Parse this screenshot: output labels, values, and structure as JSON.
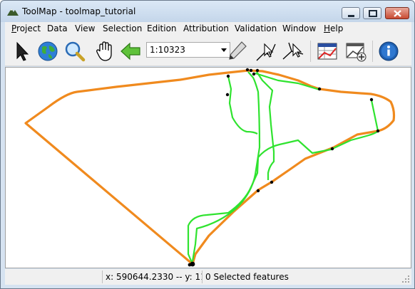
{
  "window": {
    "title": "ToolMap - toolmap_tutorial",
    "controls": [
      "minimize",
      "maximize",
      "close"
    ]
  },
  "menubar": {
    "items": [
      {
        "label": "Project"
      },
      {
        "label": "Data"
      },
      {
        "label": "View"
      },
      {
        "label": "Selection"
      },
      {
        "label": "Edition"
      },
      {
        "label": "Attribution"
      },
      {
        "label": "Validation"
      },
      {
        "label": "Window"
      },
      {
        "label": "Help"
      }
    ]
  },
  "toolbar": {
    "tools": [
      {
        "icon": "select-arrow-icon"
      },
      {
        "icon": "globe-icon"
      },
      {
        "icon": "zoom-magnifier-icon"
      },
      {
        "icon": "pan-hand-icon"
      },
      {
        "icon": "back-arrow-icon"
      },
      {
        "icon": "pencil-icon"
      },
      {
        "icon": "edit-vertex-icon"
      },
      {
        "icon": "modify-line-icon"
      },
      {
        "icon": "layer-table-icon"
      },
      {
        "icon": "add-layer-icon"
      },
      {
        "icon": "info-icon"
      }
    ],
    "scale": "1:10323"
  },
  "map": {
    "colors": {
      "orange_line": "#f08a1e",
      "green_line": "#2fe32f",
      "vertex": "#000000"
    }
  },
  "statusbar": {
    "coords": "x: 590644.2330 -- y: 11...",
    "selection": "0 Selected features"
  }
}
